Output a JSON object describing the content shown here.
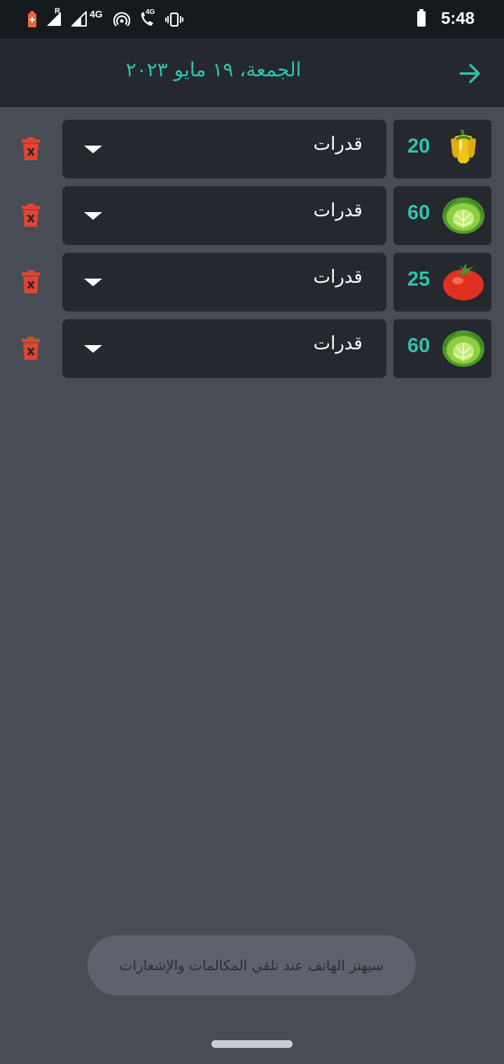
{
  "status_bar": {
    "time": "5:48",
    "network_label": "4G",
    "call_network_label": "4G",
    "roaming_label": "R",
    "icons": [
      "battery-saver-icon",
      "signal-roaming-icon",
      "signal-icon",
      "hotspot-icon",
      "wifi-calling-icon",
      "vibrate-icon",
      "battery-icon"
    ]
  },
  "app_bar": {
    "title": "الجمعة، ١٩ مايو ٢٠٢٣",
    "back_icon": "arrow-right-icon",
    "accent_color": "#2fc4ab"
  },
  "rows": [
    {
      "quantity": "20",
      "item_icon": "yellow-pepper-icon",
      "selected": "قدرات",
      "delete_icon": "trash-icon"
    },
    {
      "quantity": "60",
      "item_icon": "cabbage-icon",
      "selected": "قدرات",
      "delete_icon": "trash-icon"
    },
    {
      "quantity": "25",
      "item_icon": "tomato-icon",
      "selected": "قدرات",
      "delete_icon": "trash-icon"
    },
    {
      "quantity": "60",
      "item_icon": "cabbage-icon",
      "selected": "قدرات",
      "delete_icon": "trash-icon"
    }
  ],
  "toast": {
    "message": "سيهتز الهاتف عند تلقي المكالمات والإشعارات"
  },
  "colors": {
    "background": "#474c55",
    "card": "#25282f",
    "delete": "#e3442f"
  }
}
